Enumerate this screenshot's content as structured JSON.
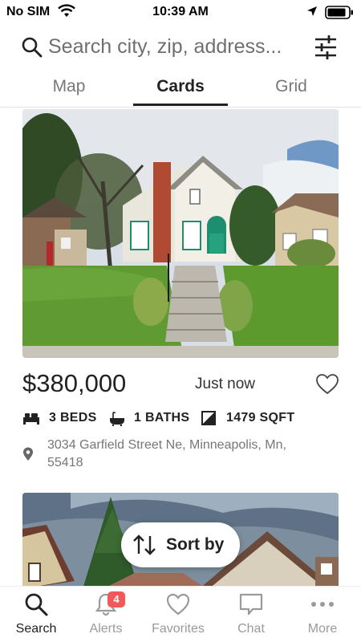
{
  "status_bar": {
    "carrier": "No SIM",
    "time": "10:39 AM"
  },
  "search": {
    "placeholder": "Search city, zip, address..."
  },
  "tabs": [
    {
      "label": "Map"
    },
    {
      "label": "Cards",
      "selected": true
    },
    {
      "label": "Grid"
    }
  ],
  "listing": {
    "price": "$380,000",
    "posted": "Just now",
    "beds": "3 BEDS",
    "baths": "1 BATHS",
    "sqft": "1479 SQFT",
    "address": "3034 Garfield Street Ne, Minneapolis, Mn, 55418"
  },
  "sort": {
    "label": "Sort by"
  },
  "bottom_nav": [
    {
      "label": "Search",
      "icon": "search-icon",
      "active": true
    },
    {
      "label": "Alerts",
      "icon": "bell-icon",
      "badge": "4"
    },
    {
      "label": "Favorites",
      "icon": "heart-icon"
    },
    {
      "label": "Chat",
      "icon": "chat-bubble-icon"
    },
    {
      "label": "More",
      "icon": "more-dots-icon"
    }
  ],
  "colors": {
    "text_primary": "#222222",
    "text_muted": "#777777",
    "badge": "#ef5b5b",
    "door_green": "#1e8f6e"
  }
}
